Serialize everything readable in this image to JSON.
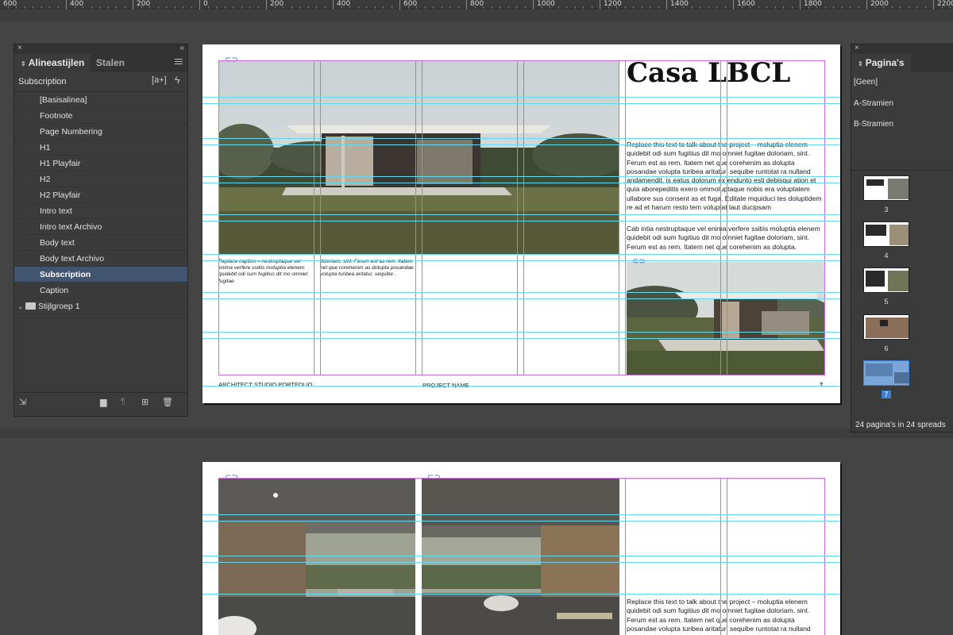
{
  "ruler": {
    "labels": [
      "600",
      "400",
      "200",
      "0",
      "200",
      "400",
      "600",
      "800",
      "1000",
      "1200",
      "1400",
      "1600",
      "1800",
      "2000",
      "2200"
    ]
  },
  "left_panel": {
    "tabs": [
      "Alineastijlen",
      "Stalen"
    ],
    "active_tab": "Alineastijlen",
    "current_style": "Subscription",
    "new_button_label": "[a+]",
    "quick_apply_label": "ϟ",
    "styles": [
      "[Basisalinea]",
      "Footnote",
      "Page Numbering",
      "H1",
      "H1 Playfair",
      "H2",
      "H2 Playfair",
      "Intro text",
      "Intro text Archivo",
      "Body text",
      "Body text Archivo",
      "Subscription",
      "Caption"
    ],
    "selected_style": "Subscription",
    "group_label": "Stijlgroep 1"
  },
  "right_panel": {
    "title": "Pagina's",
    "masters": [
      "[Geen]",
      "A-Stramien",
      "B-Stramien"
    ],
    "pages": [
      "3",
      "4",
      "5",
      "6",
      "7"
    ],
    "current_page": "7",
    "summary": "24 pagina's in 24 spreads"
  },
  "spread1": {
    "title": "Casa LBCL",
    "paragraph1": "Replace this text to talk about the project – moluptia elenem quidebit odi sum fugitius dit mo omniet fugitae doloriam, sint. Ferum est as rem. Itatem net que corehenim as dolupta posandae volupta turibea aritatur, sequibe runtotat ra nulland andamendit, is eatus dolorum ex endunto esti debisqui ation et quia aborepeditis exero ommoluptaque nobis era voluptatem ullabore sus consent as et fuga. Editate mquiduci tes doluptidem re ad et harum resto tem voluptat laut ducipsam",
    "paragraph2": "Cab intia nestruptaque vel enima verfere ssitiis moluptia elenem quidebit odi sum fugitius dit mo omniet fugitae doloriam, sint. Ferum est as rem. Itatem net que corehenim as dolupta.",
    "caption_left": "Replace caption – nestruptaque vel enima verfere ssitiis moluptia elenem quidebit odi sum fugitius dit mo omniet fugitae",
    "caption_right": "doloriam, sint. Ferum est as rem. Itatem net que corehenim as dolupta posandae volupta turibea aritatur, sequibe .",
    "footer_left": "ARCHITECT STUDIO PORTFOLIO",
    "footer_center": "PROJECT NAME",
    "page_number": "7"
  },
  "spread2": {
    "paragraph1": "Replace this text to talk about the project – moluptia elenem quidebit odi sum fugitius dit mo omniet fugitae doloriam, sint. Ferum est as rem. Itatem net que corehenim as dolupta posandae volupta turibea aritatur, sequibe runtotat ra nulland"
  },
  "icons": {
    "link": "chain-link-icon"
  },
  "colors": {
    "margin_guide": "#c96bd6",
    "ruler_guide": "#66d9ea",
    "selection": "#415470",
    "current_page": "#3c7fd0"
  }
}
